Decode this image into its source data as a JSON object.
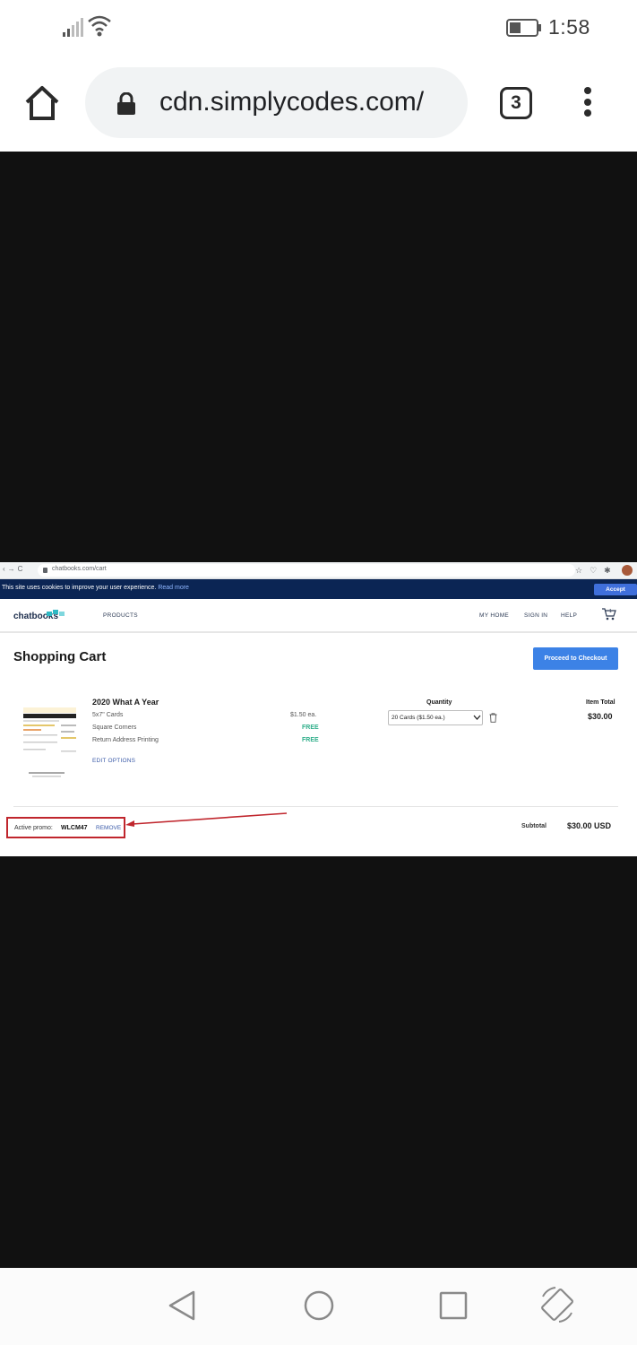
{
  "status_bar": {
    "time": "1:58",
    "icons": [
      "signal-icon",
      "wifi-icon",
      "battery-icon"
    ]
  },
  "browser": {
    "url": "cdn.simplycodes.com/",
    "tab_count": "3"
  },
  "embedded_page": {
    "mini_browser": {
      "url": "chatbooks.com/cart"
    },
    "cookie_banner": {
      "text": "This site uses cookies to improve your user experience.",
      "link": "Read more",
      "accept": "Accept"
    },
    "nav": {
      "logo": "chatbooks",
      "products": "PRODUCTS",
      "my_home": "MY HOME",
      "sign_in": "SIGN IN",
      "help": "HELP",
      "cart_count": "1"
    },
    "title": "Shopping Cart",
    "checkout_button": "Proceed to Checkout",
    "item": {
      "name": "2020 What A Year",
      "options": [
        "5x7\" Cards",
        "Square Corners",
        "Return Address Printing"
      ],
      "price_each": "$1.50 ea.",
      "square_corners_price": "FREE",
      "return_address_price": "FREE",
      "edit_options": "EDIT OPTIONS",
      "quantity_label": "Quantity",
      "quantity_value": "20 Cards ($1.50 ea.)",
      "item_total_label": "Item Total",
      "item_total": "$30.00"
    },
    "promo": {
      "label": "Active promo:",
      "code": "WLCM47",
      "remove": "REMOVE"
    },
    "subtotal_label": "Subtotal",
    "subtotal_value": "$30.00 USD"
  },
  "colors": {
    "cookie_bar": "#0b2554",
    "accept_button": "#3f6fdb",
    "checkout_button": "#3c82e6",
    "free_text": "#2fae8a",
    "promo_highlight": "#c0262d",
    "video_background": "#111111"
  }
}
